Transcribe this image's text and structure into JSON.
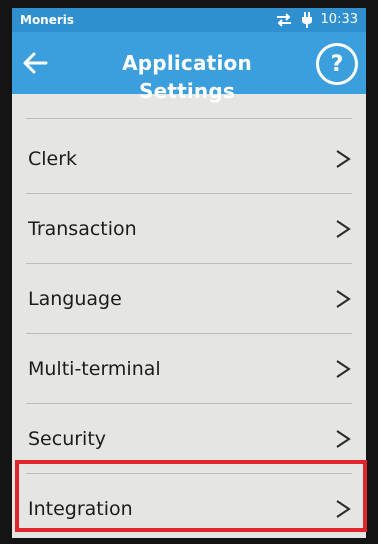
{
  "status_bar": {
    "brand": "Moneris",
    "time": "10:33",
    "icons": [
      "transfer-arrows-icon",
      "power-plug-icon"
    ]
  },
  "header": {
    "title": "Application Settings",
    "back_icon": "arrow-left-icon",
    "help_label": "?"
  },
  "settings": {
    "items": [
      {
        "label": "Clerk",
        "chevron": ">"
      },
      {
        "label": "Transaction",
        "chevron": ">"
      },
      {
        "label": "Language",
        "chevron": ">"
      },
      {
        "label": "Multi-terminal",
        "chevron": ">"
      },
      {
        "label": "Security",
        "chevron": ">"
      },
      {
        "label": "Integration",
        "chevron": ">"
      }
    ]
  },
  "colors": {
    "header_bg": "#3a9fdc",
    "status_bg": "#2f8fcf",
    "screen_bg": "#e5e5e3",
    "highlight": "#e2242c"
  }
}
